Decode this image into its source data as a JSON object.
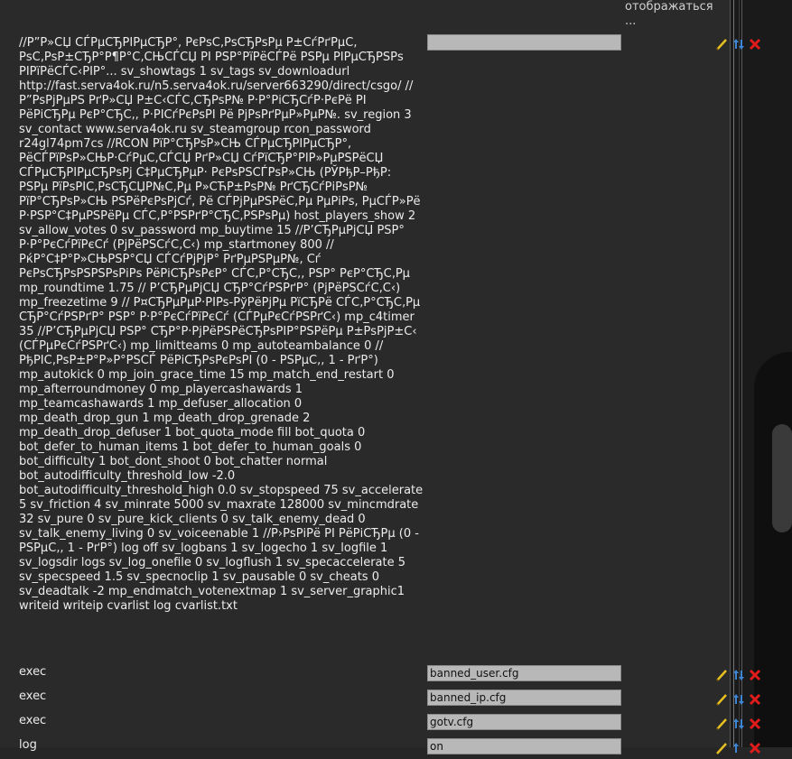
{
  "header": {
    "note": "отображаться ..."
  },
  "rows": [
    {
      "name": "//Р”Р»СЏ СЃРµСЂРІРµСЂР°, РєРѕС‚РѕСЂРѕРµ Р±СѓРґРµС‚ РѕС‚РѕР±СЂР°Р¶Р°С‚СЊСЃСЏ РІ РЅР°РїРёСЃРё РЅРµ РІРµСЂРЅРѕ РІРїРёСЃС‹РІР°... sv_showtags 1 sv_tags sv_downloadurl http://fast.serva4ok.ru/n5.serva4ok.ru/server663290/direct/csgo/ //Р”РѕРјРµРЅ РґР»СЏ Р±С‹СЃС‚СЂРѕР№ Р·Р°РіСЂСѓР·РєРё РІ РёРіСЂРµ РєР°СЂС‚, Р·РІСѓРєРѕРІ Рё РјРѕРґРµР»РµР№. sv_region 3 sv_contact www.serva4ok.ru sv_steamgroup rcon_password r24gl74pm7cs //RCON РїР°СЂРѕР»СЊ СЃРµСЂРІРµСЂР°, РёСЃРїРѕР»СЊР·СѓРµС‚СЃСЏ РґР»СЏ СѓРїСЂР°РІР»РµРЅРёСЏ СЃРµСЂРІРµСЂРѕРј С‡РµСЂРµР· РєРѕРЅСЃРѕР»СЊ (РЎРђР–РђР: РЅРµ РїРѕРІС‚РѕСЂСЏР№С‚Рµ Р»СЋР±РѕР№ РґСЂСѓРіРѕР№ РїР°СЂРѕР»СЊ РЅРёРєРѕРјСѓ, Рё СЃРјРµРЅРёС‚Рµ РµРіРѕ, РµСЃР»Рё Р·РЅР°С‡РµРЅРёРµ СЃС‚Р°РЅРґР°СЂС‚РЅРѕРµ) host_players_show 2 sv_allow_votes 0 sv_password mp_buytime 15 //Р’СЂРµРјСЏ РЅР° Р·Р°РєСѓРїРєСѓ (РјРёРЅСѓС‚С‹) mp_startmoney 800 //РќР°С‡Р°Р»СЊРЅР°СЏ СЃСѓРјРјР° РґРµРЅРµР№, Сѓ РєРѕСЂРѕРЅРЅРѕРіРѕ РёРіСЂРѕРєР° СЃС‚Р°СЂС‚, РЅР° РєР°СЂС‚Рµ mp_roundtime 1.75 // Р’СЂРµРјСЏ СЂР°СѓРЅРґР° (РјРёРЅСѓС‚С‹) mp_freezetime 9 // Р¤СЂРµРµР·РІРѕ-РўРёРјРµ РїСЂРё СЃС‚Р°СЂС‚Рµ СЂР°СѓРЅРґР° РЅР° Р·Р°РєСѓРїРєСѓ (СЃРµРєСѓРЅРґС‹) mp_c4timer 35 //Р’СЂРµРјСЏ РЅР° СЂР°Р·РјРёРЅРёСЂРѕРІР°РЅРёРµ Р±РѕРјР±С‹ (СЃРµРєСѓРЅРґС‹) mp_limitteams 0 mp_autoteambalance 0 // РђРІС‚РѕР±Р°Р»Р°РЅСЃ РёРіСЂРѕРєРѕРІ (0 - РЅРµС‚, 1 - РґР°) mp_autokick 0 mp_join_grace_time 15 mp_match_end_restart 0 mp_afterroundmoney 0 mp_playercashawards 1 mp_teamcashawards 1 mp_defuser_allocation 0 mp_death_drop_gun 1 mp_death_drop_grenade 2 mp_death_drop_defuser 1 bot_quota_mode fill bot_quota 0 bot_defer_to_human_items 1 bot_defer_to_human_goals 0 bot_difficulty 1 bot_dont_shoot 0 bot_chatter normal bot_autodifficulty_threshold_low -2.0 bot_autodifficulty_threshold_high 0.0 sv_stopspeed 75 sv_accelerate 5 sv_friction 4 sv_minrate 5000 sv_maxrate 128000 sv_mincmdrate 32 sv_pure 0 sv_pure_kick_clients 0 sv_talk_enemy_dead 0 sv_talk_enemy_living 0 sv_voiceenable 1 //Р›РѕРіРё РІ РёРіСЂРµ (0 - РЅРµС‚, 1 - РґР°) log off sv_logbans 1 sv_logecho 1 sv_logfile 1 sv_logsdir logs sv_log_onefile 0 sv_logflush 1 sv_specaccelerate 5 sv_specspeed 1.5 sv_specnoclip 1 sv_pausable 0 sv_cheats 0 sv_deadtalk -2 mp_endmatch_votenextmap 1 sv_server_graphic1 writeid writeip cvarlist log cvarlist.txt",
      "value": ""
    },
    {
      "name": "exec",
      "value": "banned_user.cfg"
    },
    {
      "name": "exec",
      "value": "banned_ip.cfg"
    },
    {
      "name": "exec",
      "value": "gotv.cfg"
    },
    {
      "name": "log",
      "value": "on"
    }
  ],
  "icons": {
    "edit": "pencil-icon",
    "move": "move-arrows-icon",
    "delete": "delete-x-icon"
  },
  "colors": {
    "background": "#262626",
    "input_bg": "#b8b8b8",
    "pencil": "#e6c020",
    "move": "#3d86d6",
    "delete": "#e01b1b"
  }
}
